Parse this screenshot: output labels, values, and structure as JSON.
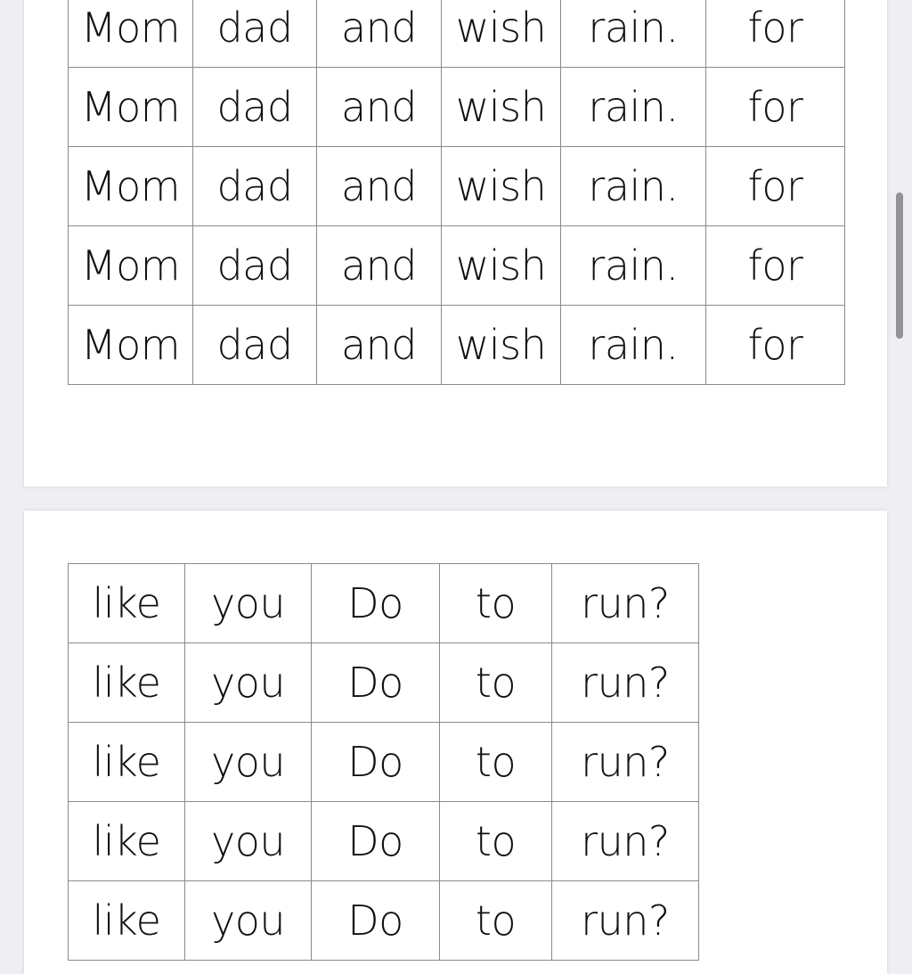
{
  "document": {
    "pages": [
      {
        "table": {
          "columns": [
            "Mom",
            "dad",
            "and",
            "wish",
            "rain.",
            "for"
          ],
          "rows": [
            [
              "Mom",
              "dad",
              "and",
              "wish",
              "rain.",
              "for"
            ],
            [
              "Mom",
              "dad",
              "and",
              "wish",
              "rain.",
              "for"
            ],
            [
              "Mom",
              "dad",
              "and",
              "wish",
              "rain.",
              "for"
            ],
            [
              "Mom",
              "dad",
              "and",
              "wish",
              "rain.",
              "for"
            ],
            [
              "Mom",
              "dad",
              "and",
              "wish",
              "rain.",
              "for"
            ]
          ]
        }
      },
      {
        "table": {
          "rows": [
            [
              "like",
              "you",
              "Do",
              "to",
              "run?"
            ],
            [
              "like",
              "you",
              "Do",
              "to",
              "run?"
            ],
            [
              "like",
              "you",
              "Do",
              "to",
              "run?"
            ],
            [
              "like",
              "you",
              "Do",
              "to",
              "run?"
            ],
            [
              "like",
              "you",
              "Do",
              "to",
              "run?"
            ]
          ]
        }
      }
    ]
  },
  "scrollbar": {
    "icon": "vertical-scrollbar"
  }
}
